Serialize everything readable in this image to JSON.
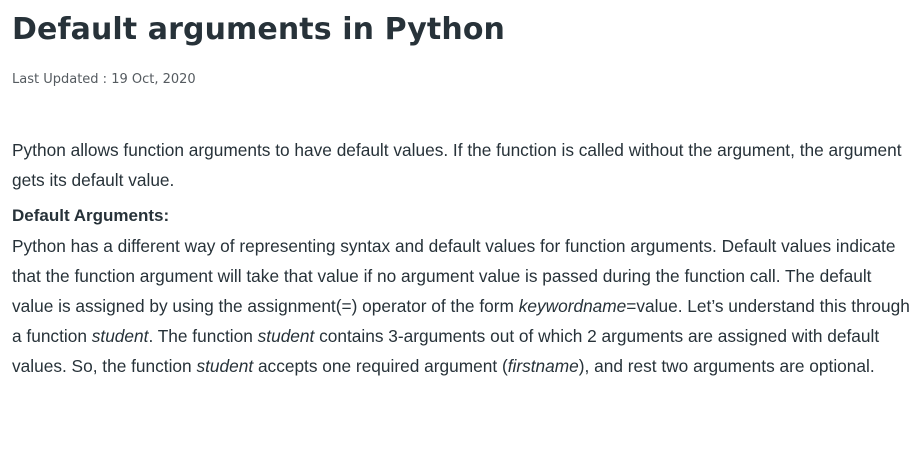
{
  "article": {
    "title": "Default arguments in Python",
    "last_updated": "Last Updated : 19 Oct, 2020",
    "intro": "Python allows function arguments to have default values. If the function is called without the argument, the argument gets its default value.",
    "section_heading": "Default Arguments:",
    "body": {
      "s1": "Python has a different way of representing syntax and default values for function arguments. Default values indicate that the function argument will take that value if no argument value is passed during the function call. The default value is assigned by using the assignment(=) operator of the form ",
      "keywordname": "keywordname",
      "s2": "=value. Let’s understand this through a function ",
      "student_1": "student",
      "s3": ". The function ",
      "student_2": "student",
      "s4": " contains 3-arguments out of which 2 arguments are assigned with default values. So, the function ",
      "student_3": "student",
      "s5": " accepts one required argument (",
      "firstname": "firstname",
      "s6": "), and rest two arguments are optional."
    }
  }
}
